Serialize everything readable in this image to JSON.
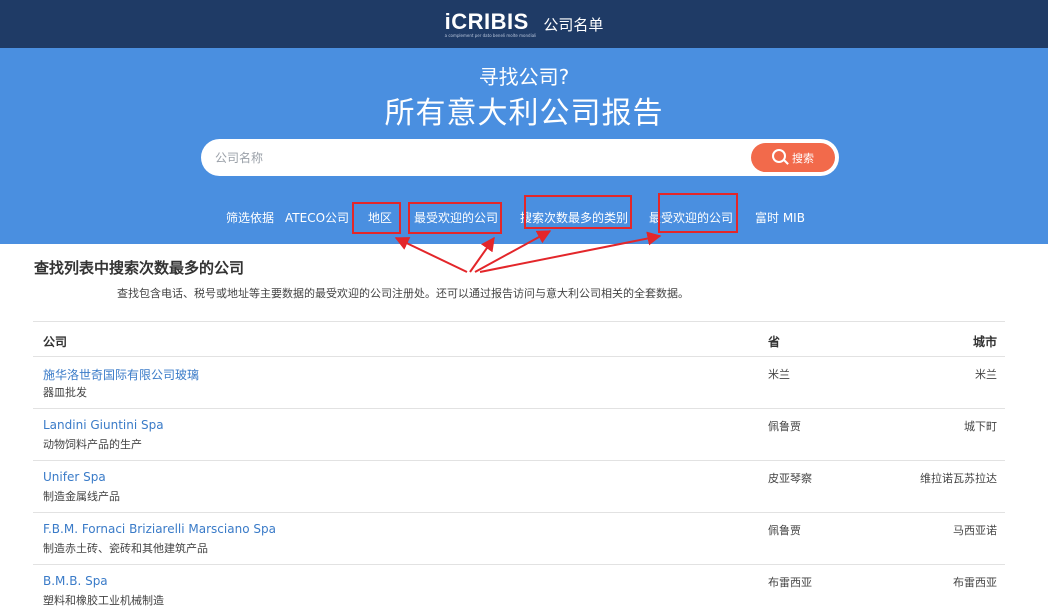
{
  "header": {
    "brand": "iCRIBIS",
    "tagline": "a complement per dato beneli molte mondiali",
    "app_name": "公司名单"
  },
  "hero": {
    "subtitle": "寻找公司?",
    "title": "所有意大利公司报告"
  },
  "search": {
    "placeholder": "公司名称",
    "value": "",
    "button_label": "搜索"
  },
  "filters": {
    "label": "筛选依据",
    "items": [
      {
        "label": "ATECO公司"
      },
      {
        "label": "地区"
      },
      {
        "label": "最受欢迎的公司"
      },
      {
        "label": "搜索次数最多的类别"
      },
      {
        "label": "最受欢迎的公司"
      },
      {
        "label": "富时 MIB"
      }
    ]
  },
  "annotation": {
    "color": "#e3262a"
  },
  "section": {
    "title": "查找列表中搜索次数最多的公司",
    "description": "查找包含电话、税号或地址等主要数据的最受欢迎的公司注册处。还可以通过报告访问与意大利公司相关的全套数据。"
  },
  "table": {
    "columns": [
      "公司",
      "省",
      "城市"
    ],
    "rows": [
      {
        "name": "施华洛世奇国际有限公司玻璃",
        "category": "器皿批发",
        "province": "米兰",
        "city": "米兰"
      },
      {
        "name": "Landini Giuntini Spa",
        "category": "动物饲料产品的生产",
        "province": "佩鲁贾",
        "city": "城下町"
      },
      {
        "name": "Unifer Spa",
        "category": "制造金属线产品",
        "province": "皮亚琴察",
        "city": "维拉诺瓦苏拉达"
      },
      {
        "name": "F.B.M. Fornaci Briziarelli Marsciano Spa",
        "category": "制造赤土砖、瓷砖和其他建筑产品",
        "province": "佩鲁贾",
        "city": "马西亚诺"
      },
      {
        "name": "B.M.B. Spa",
        "category": "塑料和橡胶工业机械制造",
        "province": "布雷西亚",
        "city": "布雷西亚"
      }
    ]
  },
  "colors": {
    "topbar": "#1f3b66",
    "hero": "#4a8fe0",
    "search_button": "#f26a4b",
    "link": "#3a7bc8"
  }
}
